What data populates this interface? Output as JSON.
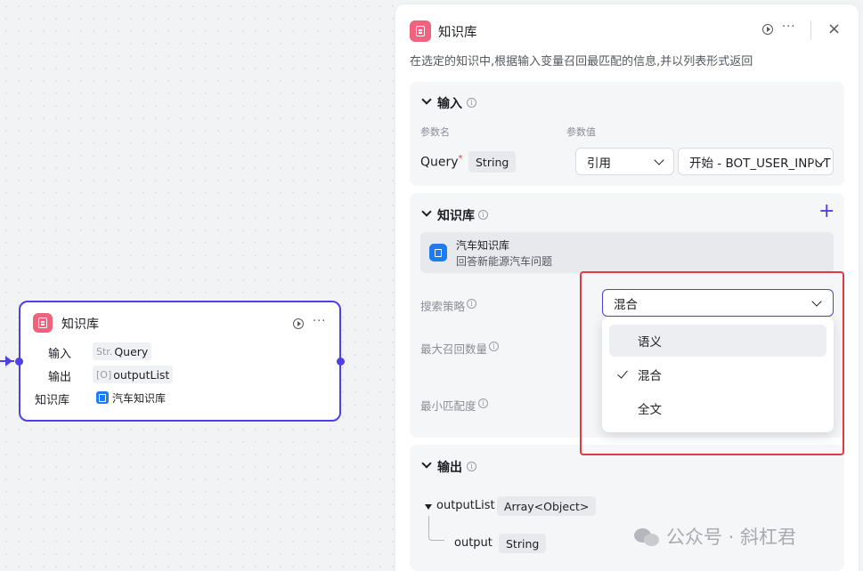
{
  "canvas_node": {
    "title": "知识库",
    "input_label": "输入",
    "input_type_prefix": "Str.",
    "input_value": "Query",
    "output_label": "输出",
    "output_type_prefix": "[O]",
    "output_value": "outputList",
    "kb_label": "知识库",
    "kb_value": "汽车知识库",
    "more": "···"
  },
  "panel": {
    "title": "知识库",
    "description": "在选定的知识中,根据输入变量召回最匹配的信息,并以列表形式返回",
    "more": "···",
    "close": "×",
    "input_section": {
      "title": "输入",
      "col_param_name": "参数名",
      "col_param_value": "参数值",
      "param_name": "Query",
      "required_mark": "*",
      "param_type": "String",
      "ref_mode": "引用",
      "ref_value": "开始 - BOT_USER_INPUT"
    },
    "kb_section": {
      "title": "知识库",
      "add": "+",
      "item_name": "汽车知识库",
      "item_desc": "回答新能源汽车问题",
      "search_strategy_label": "搜索策略",
      "search_strategy_value": "混合",
      "max_recall_label": "最大召回数量",
      "min_match_label": "最小匹配度",
      "options": [
        "语义",
        "混合",
        "全文"
      ],
      "selected_option": "混合",
      "hovered_option": "语义"
    },
    "output_section": {
      "title": "输出",
      "field_name": "outputList",
      "field_type": "Array<Object>",
      "child_name": "output",
      "child_type": "String"
    }
  },
  "watermark": "公众号 · 斜杠君",
  "colors": {
    "accent": "#4e40e5",
    "kb_icon": "#f0627e",
    "highlight_box": "#e0393e",
    "doc_icon": "#1d7bf5"
  }
}
